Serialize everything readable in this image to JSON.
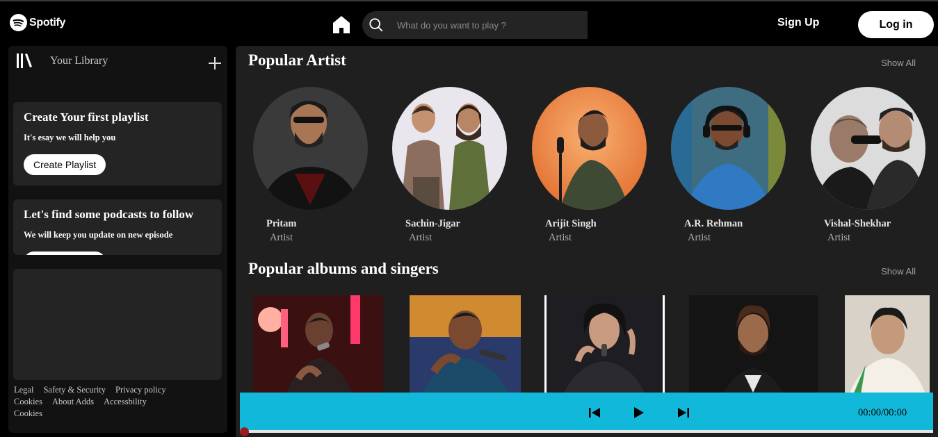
{
  "app": {
    "brand": "Spotify"
  },
  "header": {
    "search_placeholder": "What do you want to play ?",
    "signup_label": "Sign Up",
    "login_label": "Log in"
  },
  "sidebar": {
    "library_title": "Your Library",
    "cards": [
      {
        "title": "Create Your first playlist",
        "text": "It's esay we will help you",
        "button": "Create Playlist"
      },
      {
        "title": "Let's find some podcasts to follow",
        "text": "We will keep you update on new episode",
        "button": ""
      }
    ],
    "footer_links": [
      "Legal",
      "Safety & Security",
      "Privacy policy",
      "Cookies",
      "About Adds",
      "Accessbility",
      "Cookies"
    ]
  },
  "main": {
    "sections": [
      {
        "title": "Popular Artist",
        "show_all": "Show All"
      },
      {
        "title": "Popular albums and singers",
        "show_all": "Show All"
      }
    ],
    "artists": [
      {
        "name": "Pritam",
        "role": "Artist"
      },
      {
        "name": "Sachin-Jigar",
        "role": "Artist"
      },
      {
        "name": "Arijit Singh",
        "role": "Artist"
      },
      {
        "name": "A.R. Rehman",
        "role": "Artist"
      },
      {
        "name": "Vishal-Shekhar",
        "role": "Artist"
      }
    ]
  },
  "player": {
    "time": "00:00/00:00",
    "progress": 0
  },
  "colors": {
    "player_bg": "#12b8d9",
    "progress_dot": "#9b1c1c",
    "surface": "#242424",
    "main_bg": "#1f1f1f"
  }
}
